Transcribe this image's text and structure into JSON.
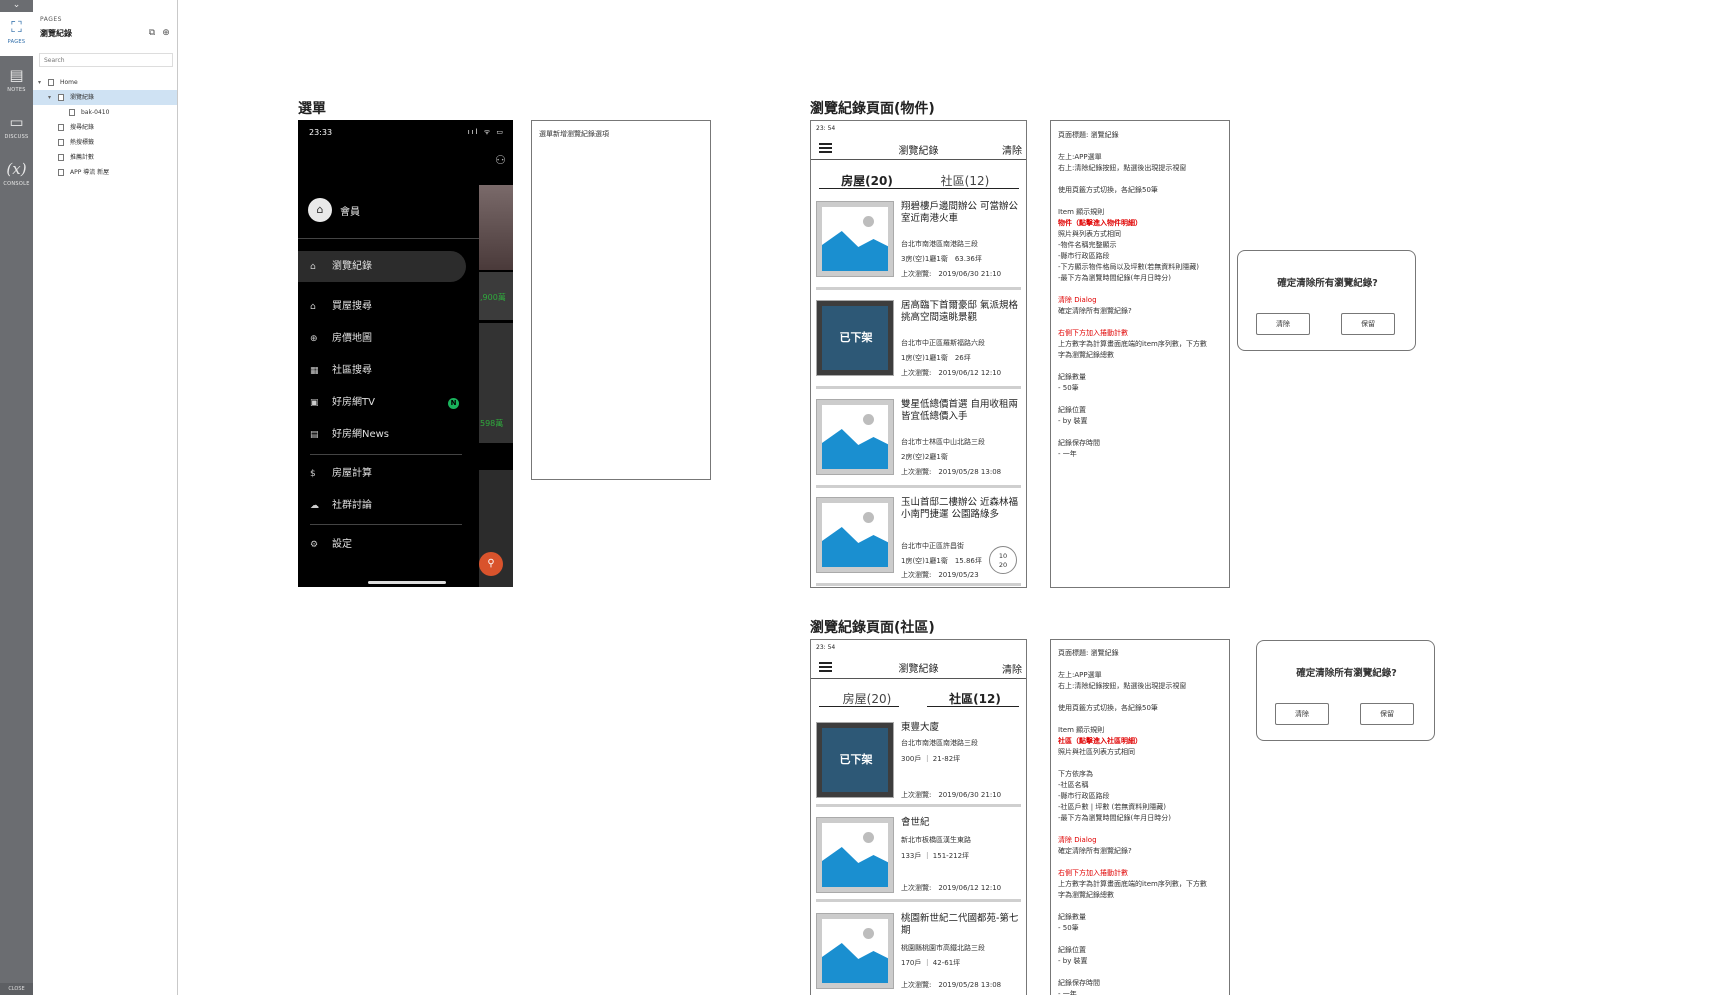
{
  "rail": {
    "items": [
      {
        "label": "PAGES",
        "icon": "sitemap-icon"
      },
      {
        "label": "NOTES",
        "icon": "notes-icon"
      },
      {
        "label": "DISCUSS",
        "icon": "discuss-icon"
      },
      {
        "label": "CONSOLE",
        "icon": "console-icon"
      }
    ],
    "close": "CLOSE"
  },
  "panel": {
    "label": "PAGES",
    "title": "瀏覽紀錄",
    "search_placeholder": "Search",
    "tree": [
      {
        "label": "Home"
      },
      {
        "label": "瀏覽紀錄"
      },
      {
        "label": "bak-0410"
      },
      {
        "label": "搜尋紀錄"
      },
      {
        "label": "熱搜標籤"
      },
      {
        "label": "推薦計數"
      },
      {
        "label": "APP 導流 新屋"
      }
    ]
  },
  "menu_section": {
    "title": "選單",
    "note": "選單新增瀏覽紀錄選項",
    "phone": {
      "time": "23:33",
      "status": "ııl ᯤ ▭",
      "user": "會員",
      "items": [
        {
          "label": "瀏覽紀錄"
        },
        {
          "label": "買屋搜尋"
        },
        {
          "label": "房價地圖"
        },
        {
          "label": "社區搜尋"
        },
        {
          "label": "好房網TV",
          "badge": "N"
        },
        {
          "label": "好房網News"
        },
        {
          "label": "房屋計算"
        },
        {
          "label": "社群討論"
        },
        {
          "label": "設定"
        }
      ],
      "strip_prices": [
        ",900萬",
        "598萬"
      ]
    }
  },
  "house_section": {
    "title": "瀏覽紀錄頁面(物件)",
    "frame": {
      "time": "23: 54",
      "header_title": "瀏覽紀錄",
      "clear": "清除",
      "tabs": [
        {
          "label": "房屋(20)",
          "active": true
        },
        {
          "label": "社區(12)",
          "active": false
        }
      ],
      "cards": [
        {
          "title": "翔碧樓戶邊間辦公 可當辦公室近南港火車",
          "address": "台北市南港區南港路三段",
          "spec": "3房(空)1廳1衛　63.36坪",
          "last": "上次瀏覽:　2019/06/30 21:10",
          "off": false
        },
        {
          "title": "居高臨下首爾豪邸 氣派規格挑高空間遠眺景觀",
          "address": "台北市中正區羅斯福路六段",
          "spec": "1房(空)1廳1衛　26坪",
          "last": "上次瀏覽:　2019/06/12 12:10",
          "off": true,
          "off_label": "已下架"
        },
        {
          "title": "雙星低總價首選 自用收租兩皆宜低總價入手",
          "address": "台北市士林區中山北路三段",
          "spec": "2房(空)2廳1衛",
          "last": "上次瀏覽:　2019/05/28 13:08",
          "off": false
        },
        {
          "title": "玉山首邸二樓辦公 近森林福小南門捷運 公園路綠多",
          "address": "台北市中正區許昌街",
          "spec": "1房(空)1廳1衛　15.86坪",
          "last": "上次瀏覽:　2019/05/23",
          "off": false
        }
      ],
      "pager": {
        "current": "10",
        "total": "20"
      }
    },
    "notes": [
      {
        "text": "頁面標題: 瀏覽紀錄",
        "style": ""
      },
      {
        "text": "",
        "style": ""
      },
      {
        "text": "左上:APP選單",
        "style": ""
      },
      {
        "text": "右上:清除紀錄按鈕，點選後出現提示視窗",
        "style": ""
      },
      {
        "text": "",
        "style": ""
      },
      {
        "text": "使用頁籤方式切換，各紀錄50筆",
        "style": ""
      },
      {
        "text": "",
        "style": ""
      },
      {
        "text": "Item 顯示規則",
        "style": ""
      },
      {
        "text": "物件（點擊進入物件明細）",
        "style": "redb"
      },
      {
        "text": "照片與列表方式相同",
        "style": ""
      },
      {
        "text": "-物件名稱完整顯示",
        "style": ""
      },
      {
        "text": "-縣市行政區路段",
        "style": ""
      },
      {
        "text": "-下方顯示物件格局以及坪數(若無資料則隱藏)",
        "style": ""
      },
      {
        "text": "-最下方為瀏覽時間紀錄(年月日時分)",
        "style": ""
      },
      {
        "text": "",
        "style": ""
      },
      {
        "text": "清除 Dialog",
        "style": "red"
      },
      {
        "text": "確定清除所有瀏覽紀錄?",
        "style": ""
      },
      {
        "text": "",
        "style": ""
      },
      {
        "text": "右側下方加入捲動計數",
        "style": "red"
      },
      {
        "text": "上方數字為計算畫面底端的item序列數，下方數",
        "style": ""
      },
      {
        "text": "字為瀏覽紀錄總數",
        "style": ""
      },
      {
        "text": "",
        "style": ""
      },
      {
        "text": "紀錄數量",
        "style": ""
      },
      {
        "text": "- 50筆",
        "style": ""
      },
      {
        "text": "",
        "style": ""
      },
      {
        "text": "紀錄位置",
        "style": ""
      },
      {
        "text": "- by 裝置",
        "style": ""
      },
      {
        "text": "",
        "style": ""
      },
      {
        "text": "紀錄保存時間",
        "style": ""
      },
      {
        "text": "- 一年",
        "style": ""
      }
    ],
    "dialog": {
      "question": "確定清除所有瀏覽紀錄?",
      "confirm": "清除",
      "cancel": "保留"
    }
  },
  "community_section": {
    "title": "瀏覽紀錄頁面(社區)",
    "frame": {
      "time": "23: 54",
      "header_title": "瀏覽紀錄",
      "clear": "清除",
      "tabs": [
        {
          "label": "房屋(20)",
          "active": false
        },
        {
          "label": "社區(12)",
          "active": true
        }
      ],
      "cards": [
        {
          "title": "東豐大廈",
          "address": "台北市南港區南港路三段",
          "spec": "300戶 ｜ 21-82坪",
          "last": "上次瀏覽:　2019/06/30 21:10",
          "off": true,
          "off_label": "已下架"
        },
        {
          "title": "會世紀",
          "address": "新北市板橋區漢生東路",
          "spec": "133戶 ｜ 151-212坪",
          "last": "上次瀏覽:　2019/06/12 12:10",
          "off": false
        },
        {
          "title": "桃園新世紀二代國都苑-第七期",
          "address": "桃園縣桃園市高鐵北路三段",
          "spec": "170戶 ｜ 42-61坪",
          "last": "上次瀏覽:　2019/05/28 13:08",
          "off": false
        }
      ]
    },
    "notes": [
      {
        "text": "頁面標題: 瀏覽紀錄",
        "style": ""
      },
      {
        "text": "",
        "style": ""
      },
      {
        "text": "左上:APP選單",
        "style": ""
      },
      {
        "text": "右上:清除紀錄按鈕，點選後出現提示視窗",
        "style": ""
      },
      {
        "text": "",
        "style": ""
      },
      {
        "text": "使用頁籤方式切換，各紀錄50筆",
        "style": ""
      },
      {
        "text": "",
        "style": ""
      },
      {
        "text": "Item 顯示規則",
        "style": ""
      },
      {
        "text": "社區（點擊進入社區明細）",
        "style": "redb"
      },
      {
        "text": "照片與社區列表方式相同",
        "style": ""
      },
      {
        "text": "",
        "style": ""
      },
      {
        "text": "下方依序為",
        "style": ""
      },
      {
        "text": "-社區名稱",
        "style": ""
      },
      {
        "text": "-縣市行政區路段",
        "style": ""
      },
      {
        "text": "-社區戶數 | 坪數 (若無資料則隱藏)",
        "style": ""
      },
      {
        "text": "-最下方為瀏覽時間紀錄(年月日時分)",
        "style": ""
      },
      {
        "text": "",
        "style": ""
      },
      {
        "text": "清除 Dialog",
        "style": "red"
      },
      {
        "text": "確定清除所有瀏覽紀錄?",
        "style": ""
      },
      {
        "text": "",
        "style": ""
      },
      {
        "text": "右側下方加入捲動計數",
        "style": "red"
      },
      {
        "text": "上方數字為計算畫面底端的item序列數，下方數",
        "style": ""
      },
      {
        "text": "字為瀏覽紀錄總數",
        "style": ""
      },
      {
        "text": "",
        "style": ""
      },
      {
        "text": "紀錄數量",
        "style": ""
      },
      {
        "text": "- 50筆",
        "style": ""
      },
      {
        "text": "",
        "style": ""
      },
      {
        "text": "紀錄位置",
        "style": ""
      },
      {
        "text": "- by 裝置",
        "style": ""
      },
      {
        "text": "",
        "style": ""
      },
      {
        "text": "紀錄保存時間",
        "style": ""
      },
      {
        "text": "- 一年",
        "style": ""
      }
    ],
    "dialog": {
      "question": "確定清除所有瀏覽紀錄?",
      "confirm": "清除",
      "cancel": "保留"
    }
  },
  "colors": {
    "accent": "#1a8fd0",
    "red_note": "#e00000",
    "rail": "#6b6d71",
    "selected_row": "#cfe2f3",
    "badge": "#19b35c"
  }
}
